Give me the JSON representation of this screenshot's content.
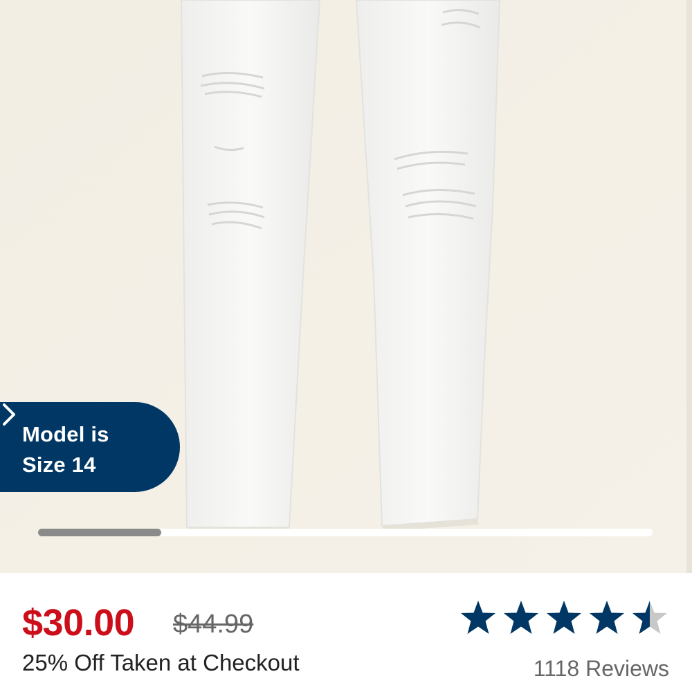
{
  "product_image": {
    "alt_icon": "jeans-photo",
    "background": "#f3efe6"
  },
  "model_badge": {
    "line1": "Model is",
    "line2": "Size 14",
    "color": "#003764",
    "icon": "chevron-right-icon"
  },
  "carousel": {
    "progress": 0.2
  },
  "pricing": {
    "sale_price": "$30.00",
    "original_price": "$44.99",
    "discount_text": "25% Off Taken at Checkout",
    "sale_color": "#cc0e1b"
  },
  "rating": {
    "value": 4.5,
    "max": 5,
    "star_color": "#003764",
    "reviews_label": "1118 Reviews"
  }
}
